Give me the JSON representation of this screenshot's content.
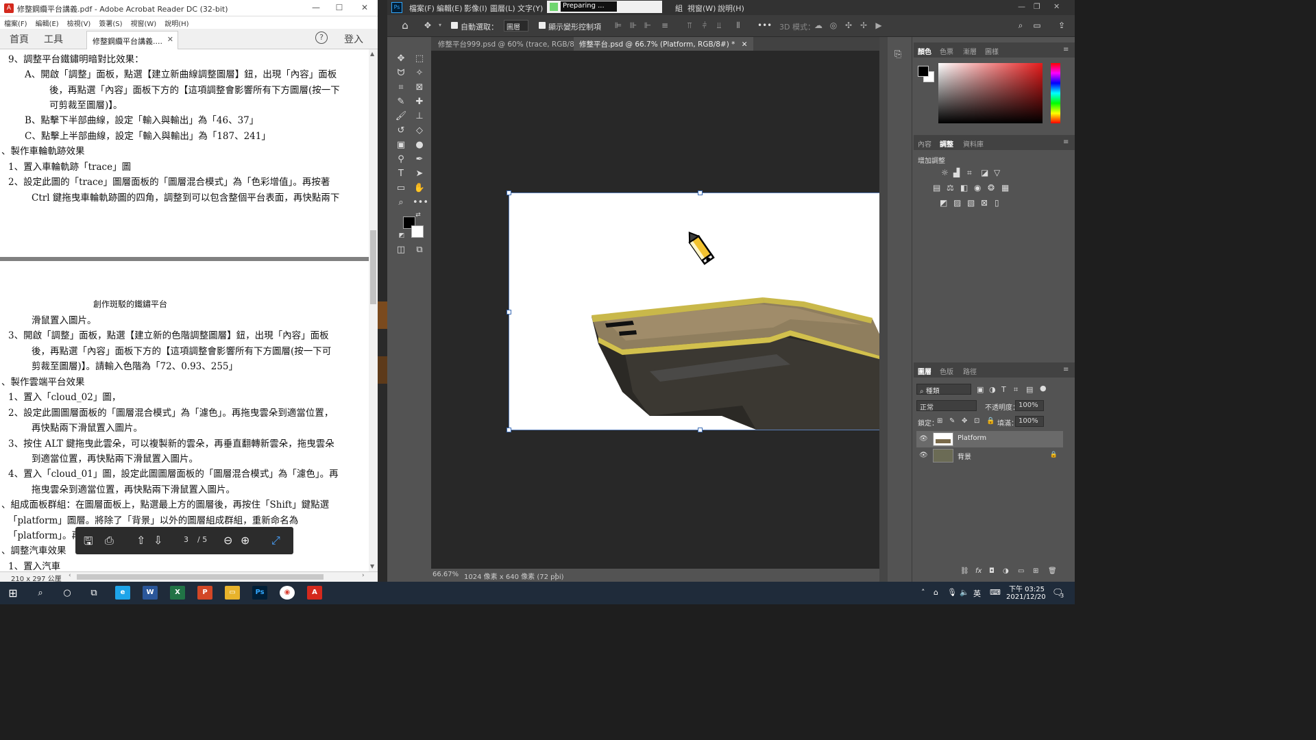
{
  "acrobat": {
    "title": "修整鋼纜平台講義.pdf - Adobe Acrobat Reader DC (32-bit)",
    "menu": [
      "檔案(F)",
      "編輯(E)",
      "檢視(V)",
      "簽署(S)",
      "視窗(W)",
      "說明(H)"
    ],
    "home_tab": "首頁",
    "tools_tab": "工具",
    "doc_tab": "修整鋼纜平台講義....",
    "help": "?",
    "login": "登入",
    "page1_lines": [
      "9、調整平台鐵鏽明暗對比效果：",
      "A、開啟「調整」面板，點選【建立新曲線調整圖層】鈕，出現「內容」面板",
      "後，再點選「內容」面板下方的【這項調整會影響所有下方圖層(按一下",
      "可剪裁至圖層)】。",
      "B、點擊下半部曲線，設定「輸入與輸出」為「46、37」",
      "C、點擊上半部曲線，設定「輸入與輸出」為「187、241」",
      "、製作車輪軌跡效果",
      "1、置入車輪軌跡「trace」圖",
      "2、設定此圖的「trace」圖層面板的「圖層混合模式」為「色彩增值」。再按著",
      "Ctrl 鍵拖曳車輪軌跡圖的四角，調整到可以包含整個平台表面，再快點兩下"
    ],
    "page2_header": "創作斑駁的鐵鏽平台",
    "page2_lines": [
      "滑鼠置入圖片。",
      "3、開啟「調整」面板，點選【建立新的色階調整圖層】鈕，出現「內容」面板",
      "後，再點選「內容」面板下方的【這項調整會影響所有下方圖層(按一下可",
      "剪裁至圖層)】。請輸入色階為「72、0.93、255」",
      "、製作雲端平台效果",
      "1、置入「cloud_02」圖，",
      "2、設定此圖圖層面板的「圖層混合模式」為「濾色」。再拖曳雲朵到適當位置，",
      "再快點兩下滑鼠置入圖片。",
      "3、按住 ALT 鍵拖曳此雲朵，可以複製新的雲朵，再垂直翻轉新雲朵，拖曳雲朵",
      "到適當位置，再快點兩下滑鼠置入圖片。",
      "4、置入「cloud_01」圖，設定此圖圖層面板的「圖層混合模式」為「濾色」。再",
      "拖曳雲朵到適當位置，再快點兩下滑鼠置入圖片。",
      "、組成面板群組：在圖層面板上，點選最上方的圖層後，再按住「Shift」鍵點選",
      "「platform」圖層。將除了「背景」以外的圖層組成群組，重新命名為",
      "「platform」。再",
      "、調整汽車效果",
      "1、置入汽車"
    ],
    "page_current": "3",
    "page_total": "/ 5",
    "page_size": "210 x 297 公厘"
  },
  "photoshop": {
    "menu": [
      "檔案(F)",
      "編輯(E)",
      "影像(I)",
      "圖層(L)",
      "文字(Y)",
      "視窗(W)",
      "說明(H)"
    ],
    "menu_partial": "組",
    "preparing": "Preparing ...",
    "options": {
      "auto_select_label": "自動選取：",
      "auto_select_value": "圖層",
      "show_transform": "顯示變形控制項",
      "mode_3d": "3D 模式："
    },
    "tabs": [
      "修整平台999.psd @ 60% (trace, RGB/8#) *",
      "修整平台.psd @ 66.7% (Platform, RGB/8#) *"
    ],
    "zoom": "66.67%",
    "doc_info": "1024 像素 x 640 像素 (72 ppi)",
    "color_panel_tabs": [
      "顏色",
      "色票",
      "漸層",
      "圖樣"
    ],
    "adjust_panel_tabs": [
      "內容",
      "調整",
      "資料庫"
    ],
    "adjust_title": "增加調整",
    "layers_panel_tabs": [
      "圖層",
      "色版",
      "路徑"
    ],
    "layer_filter": "種類",
    "blend_mode": "正常",
    "opacity_label": "不透明度：",
    "opacity_value": "100%",
    "lock_label": "鎖定：",
    "fill_label": "填滿：",
    "fill_value": "100%",
    "layers": [
      {
        "name": "Platform"
      },
      {
        "name": "背景"
      }
    ]
  },
  "taskbar": {
    "ime": "英",
    "time": "下午 03:25",
    "date": "2021/12/20",
    "notif_count": "3"
  }
}
